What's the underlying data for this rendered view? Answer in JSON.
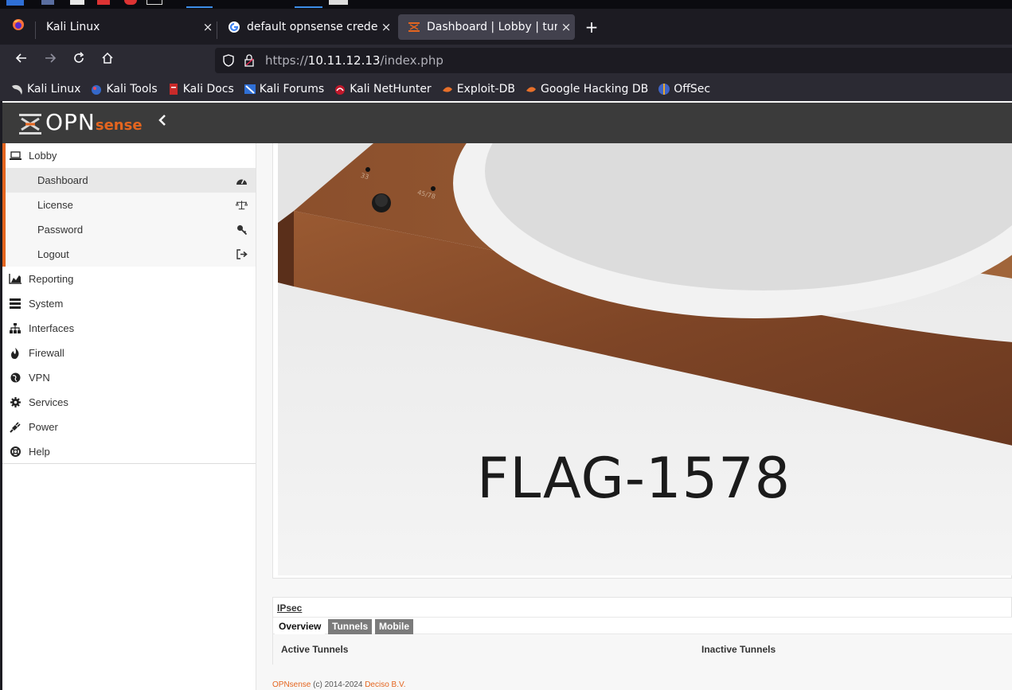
{
  "browser": {
    "tabs": [
      {
        "label": "Kali Linux",
        "icon": "kali-dragon-icon",
        "close": "×",
        "active": false
      },
      {
        "label": "default opnsense credentials",
        "icon": "google-icon",
        "close": "×",
        "active": false
      },
      {
        "label": "Dashboard | Lobby | turntable",
        "icon": "opnsense-icon",
        "close": "×",
        "active": true
      }
    ],
    "new_tab": "+",
    "url_prefix": "https://",
    "url_host": "10.11.12.13",
    "url_path": "/index.php",
    "bookmarks": [
      {
        "label": "Kali Linux",
        "icon": "kali-dragon-icon"
      },
      {
        "label": "Kali Tools",
        "icon": "kali-tools-icon"
      },
      {
        "label": "Kali Docs",
        "icon": "kali-docs-icon"
      },
      {
        "label": "Kali Forums",
        "icon": "kali-forums-icon"
      },
      {
        "label": "Kali NetHunter",
        "icon": "nethunter-icon"
      },
      {
        "label": "Exploit-DB",
        "icon": "exploit-db-icon"
      },
      {
        "label": "Google Hacking DB",
        "icon": "ghdb-icon"
      },
      {
        "label": "OffSec",
        "icon": "offsec-icon"
      }
    ],
    "accent": "#3d8ee8"
  },
  "opnsense": {
    "logo_main": "OPN",
    "logo_sense": "sense",
    "brand_color": "#e4651f",
    "menu": {
      "lobby": {
        "label": "Lobby",
        "items": [
          {
            "label": "Dashboard",
            "icon": "dashboard-gauge-icon",
            "active": true
          },
          {
            "label": "License",
            "icon": "balance-scale-icon"
          },
          {
            "label": "Password",
            "icon": "key-icon"
          },
          {
            "label": "Logout",
            "icon": "sign-out-icon"
          }
        ]
      },
      "top": [
        {
          "label": "Reporting",
          "icon": "area-chart-icon"
        },
        {
          "label": "System",
          "icon": "server-icon"
        },
        {
          "label": "Interfaces",
          "icon": "sitemap-icon"
        },
        {
          "label": "Firewall",
          "icon": "fire-icon"
        },
        {
          "label": "VPN",
          "icon": "globe-icon"
        },
        {
          "label": "Services",
          "icon": "cog-icon"
        },
        {
          "label": "Power",
          "icon": "plug-icon"
        },
        {
          "label": "Help",
          "icon": "life-ring-icon"
        }
      ]
    }
  },
  "dashboard": {
    "photo_labels": {
      "speed_33": "33",
      "speed_4578": "45/78"
    },
    "flag_text": "FLAG-1578",
    "ipsec": {
      "title": "IPsec",
      "tabs": [
        "Overview",
        "Tunnels",
        "Mobile"
      ],
      "columns": [
        "Active Tunnels",
        "Inactive Tunnels"
      ]
    },
    "footer": {
      "brand": "OPNsense",
      "copyright": "(c) 2014-2024",
      "company": "Deciso B.V."
    }
  }
}
